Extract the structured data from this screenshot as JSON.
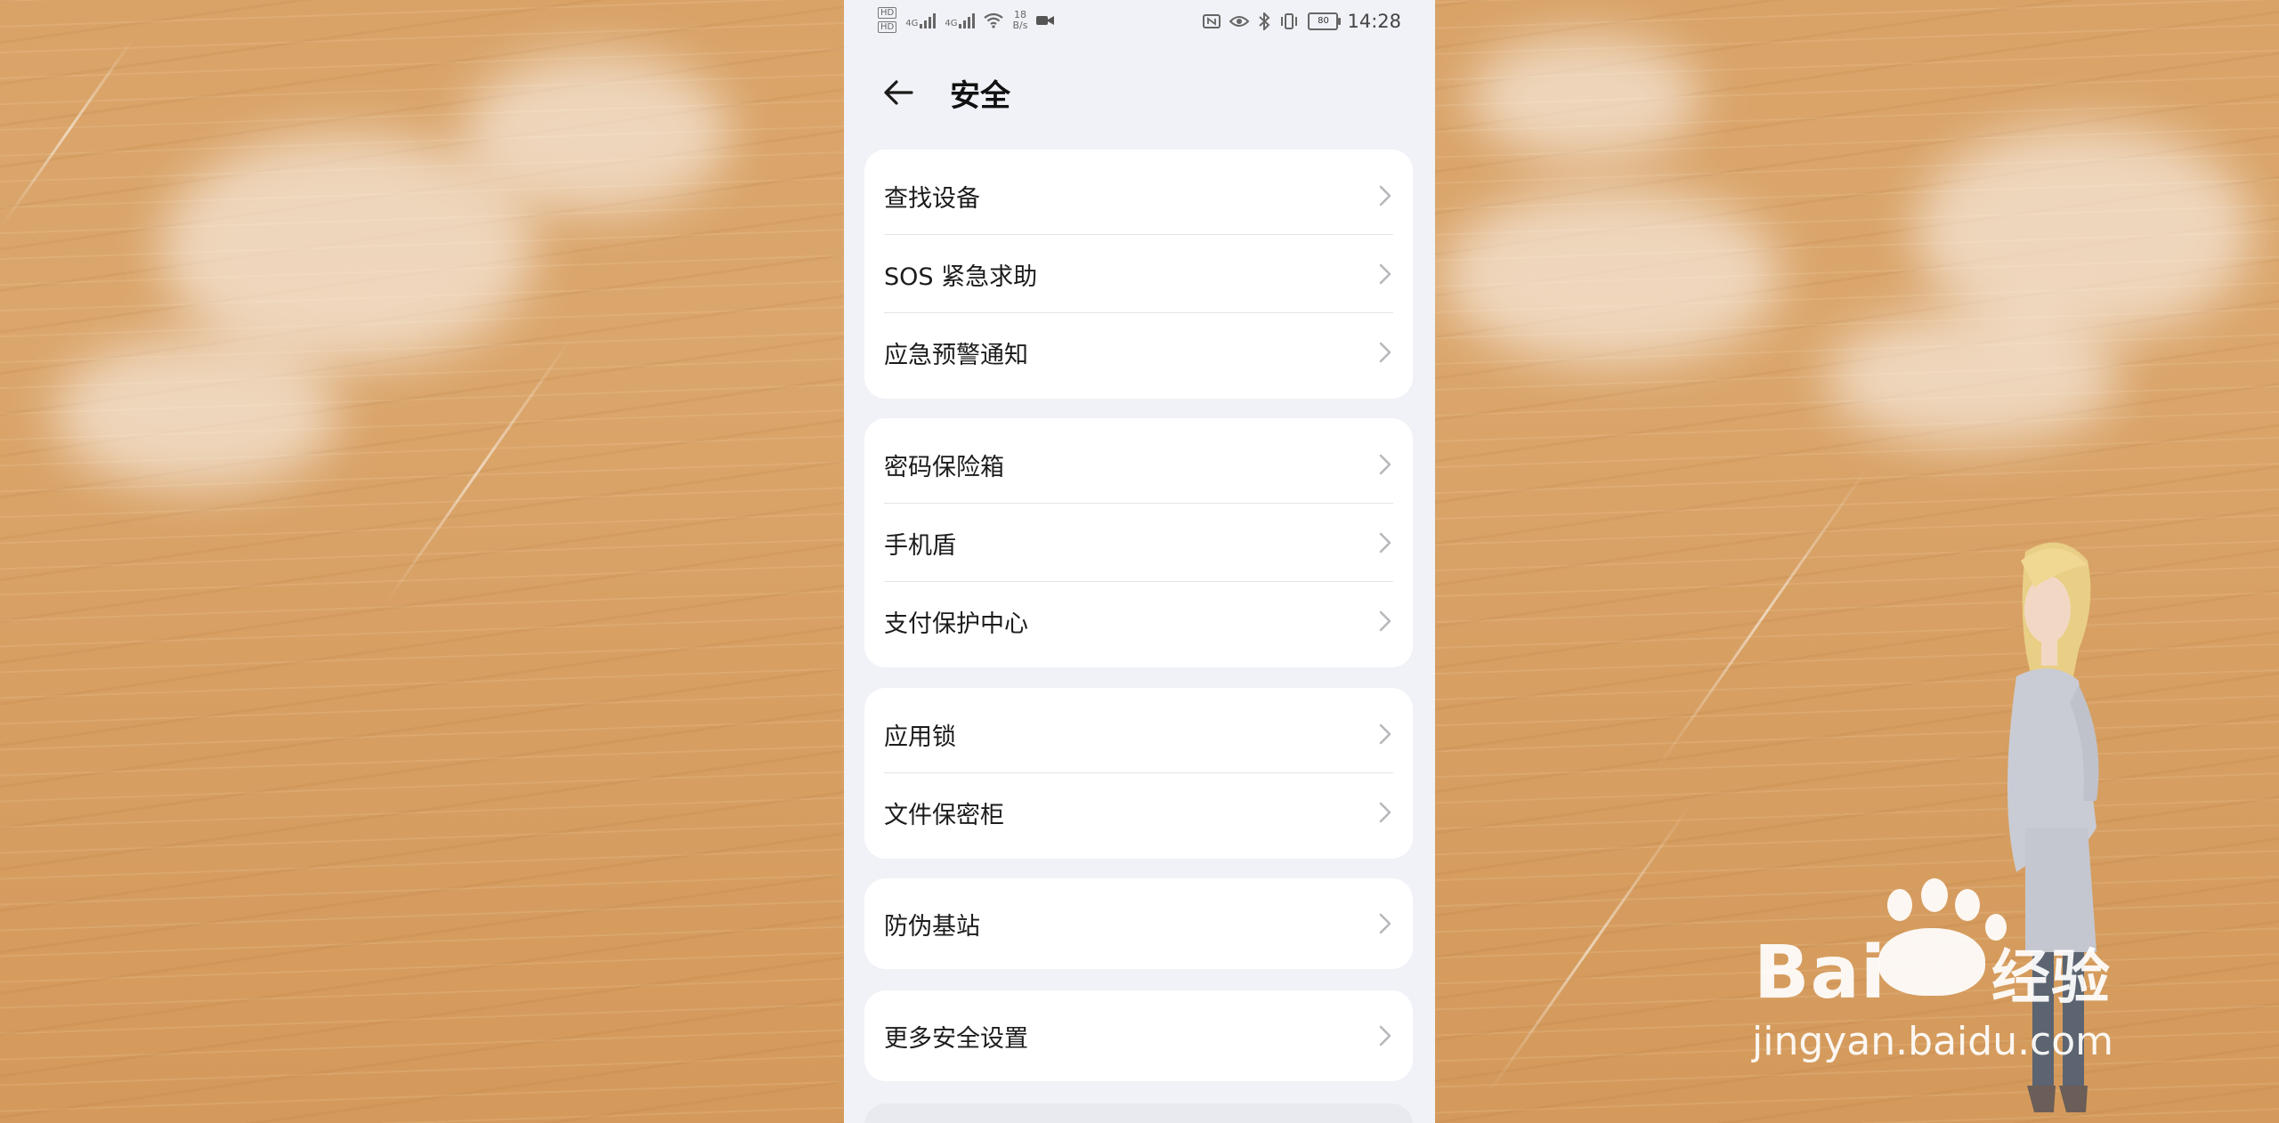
{
  "status_bar": {
    "left_badges": [
      "HD",
      "HD"
    ],
    "network_generation": [
      "4G",
      "4G"
    ],
    "speed_value": "18",
    "speed_unit": "B/s",
    "time": "14:28",
    "battery": "80"
  },
  "header": {
    "title": "安全"
  },
  "groups": [
    {
      "items": [
        {
          "label": "查找设备"
        },
        {
          "label": "SOS 紧急求助"
        },
        {
          "label": "应急预警通知"
        }
      ]
    },
    {
      "items": [
        {
          "label": "密码保险箱"
        },
        {
          "label": "手机盾"
        },
        {
          "label": "支付保护中心"
        }
      ]
    },
    {
      "items": [
        {
          "label": "应用锁"
        },
        {
          "label": "文件保密柜"
        }
      ]
    },
    {
      "items": [
        {
          "label": "防伪基站"
        }
      ]
    },
    {
      "items": [
        {
          "label": "更多安全设置"
        }
      ]
    }
  ],
  "watermark": {
    "brand_left": "Bai",
    "brand_right": "经验",
    "url": "jingyan.baidu.com"
  },
  "icons": {
    "back": "arrow-left-icon",
    "chevron": "chevron-right-icon"
  }
}
